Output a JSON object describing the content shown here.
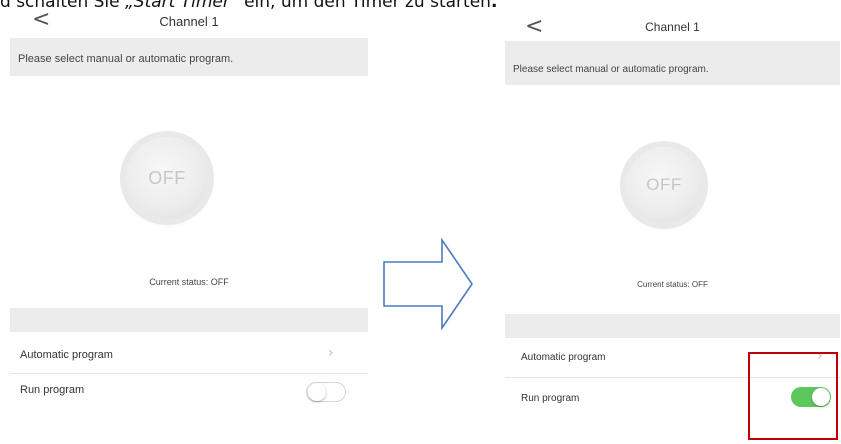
{
  "caption": {
    "prefix": "d schalten Sie ",
    "emphasis": "„Start Timer“",
    "suffix": " ein, um den Timer zu starten",
    "end_mark": "."
  },
  "screens": {
    "left": {
      "title": "Channel 1",
      "back_glyph": "<",
      "hint": "Please select manual or automatic program.",
      "power_label": "OFF",
      "status": "Current status: OFF",
      "automatic_program_label": "Automatic program",
      "run_program_label": "Run program",
      "run_program_on": false
    },
    "right": {
      "title": "Channel 1",
      "back_glyph": "<",
      "hint": "Please select manual or automatic program.",
      "power_label": "OFF",
      "status": "Current status: OFF",
      "automatic_program_label": "Automatic program",
      "run_program_label": "Run program",
      "run_program_on": true
    }
  },
  "colors": {
    "toggle_on": "#5cc85c",
    "highlight_border": "#c00000",
    "arrow_stroke": "#4a7bbf"
  },
  "icons": {
    "back": "chevron-left-icon",
    "row_chevron": "chevron-right-icon",
    "transition": "arrow-right-icon"
  }
}
